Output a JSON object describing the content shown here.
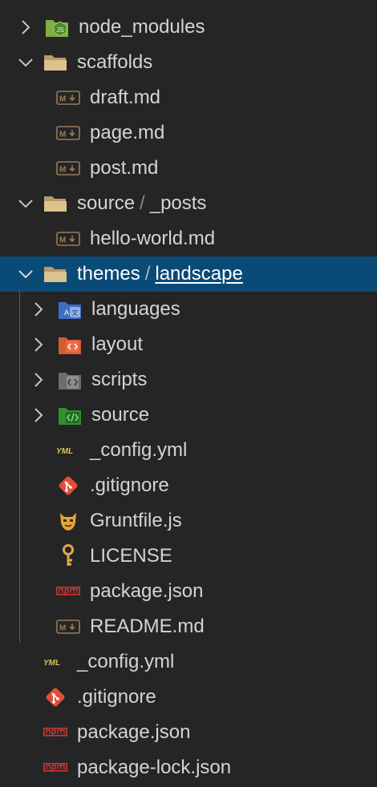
{
  "tree": {
    "root_items": [
      {
        "label": "node_modules"
      },
      {
        "label": "scaffolds"
      },
      {
        "label": "draft.md"
      },
      {
        "label": "page.md"
      },
      {
        "label": "post.md"
      },
      {
        "label": "source",
        "compact": "_posts"
      },
      {
        "label": "hello-world.md"
      },
      {
        "label": "themes",
        "compact": "landscape"
      },
      {
        "label": "languages"
      },
      {
        "label": "layout"
      },
      {
        "label": "scripts"
      },
      {
        "label": "source"
      },
      {
        "label": "_config.yml"
      },
      {
        "label": ".gitignore"
      },
      {
        "label": "Gruntfile.js"
      },
      {
        "label": "LICENSE"
      },
      {
        "label": "package.json"
      },
      {
        "label": "README.md"
      },
      {
        "label": "_config.yml"
      },
      {
        "label": ".gitignore"
      },
      {
        "label": "package.json"
      },
      {
        "label": "package-lock.json"
      }
    ],
    "separator": "/",
    "selected_row": "themes / landscape",
    "icons": [
      "nodejs-folder-icon",
      "folder-open-icon",
      "markdown-icon",
      "markdown-icon",
      "markdown-icon",
      "folder-open-icon",
      "markdown-icon",
      "folder-open-icon",
      "translate-folder-icon",
      "html-folder-icon",
      "script-folder-icon",
      "source-folder-icon",
      "yaml-icon",
      "git-icon",
      "grunt-icon",
      "license-key-icon",
      "npm-icon",
      "markdown-icon",
      "yaml-icon",
      "git-icon",
      "npm-icon",
      "npm-icon"
    ],
    "colors": {
      "background": "#252526",
      "selected": "#0a4a77",
      "folder": "#dcc28e",
      "markdown": "#9a7d59",
      "npm": "#cb3837",
      "git": "#e44d38",
      "yaml": "#d6c45c"
    }
  }
}
